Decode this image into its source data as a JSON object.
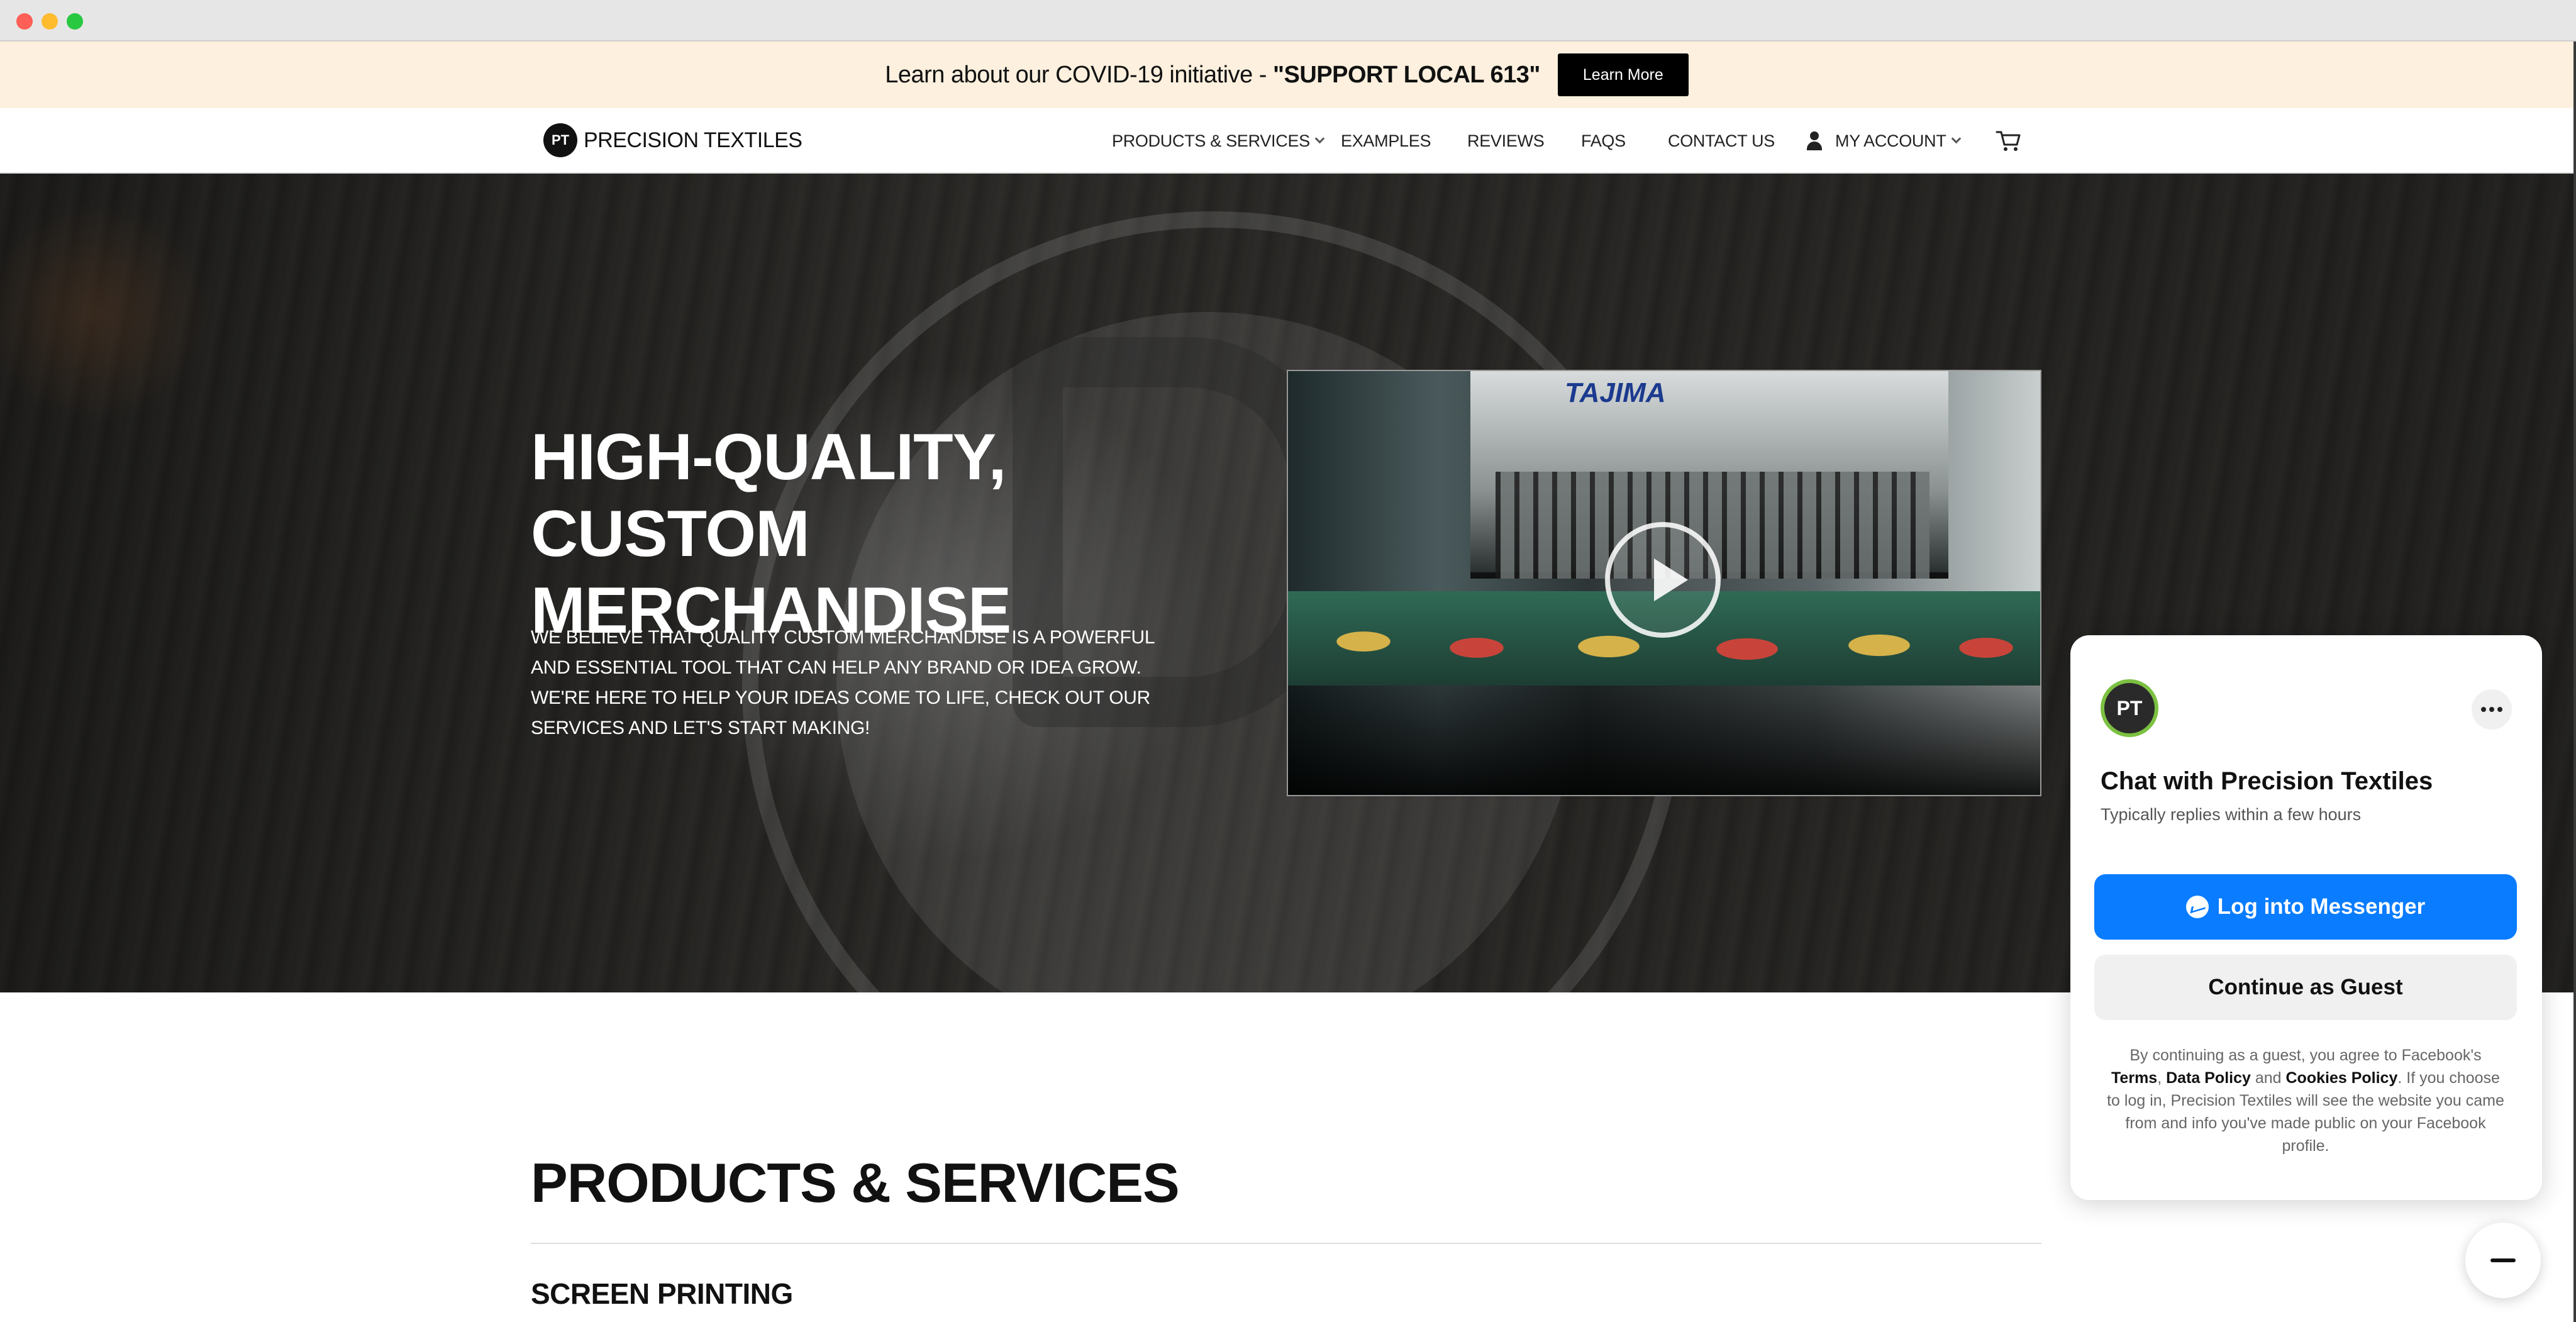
{
  "banner": {
    "text_prefix": "Learn about our COVID-19 initiative - ",
    "text_bold": "\"SUPPORT LOCAL 613\"",
    "button_label": "Learn More"
  },
  "nav": {
    "brand": "PRECISION TEXTILES",
    "items": [
      {
        "label": "PRODUCTS & SERVICES",
        "has_dropdown": true
      },
      {
        "label": "EXAMPLES"
      },
      {
        "label": "REVIEWS"
      },
      {
        "label": "FAQS"
      },
      {
        "label": "CONTACT US"
      },
      {
        "label": "MY ACCOUNT",
        "has_dropdown": true,
        "icon": "user-icon"
      }
    ],
    "cart_icon": "cart-icon"
  },
  "hero": {
    "title": "HIGH-QUALITY, CUSTOM MERCHANDISE",
    "body": "WE BELIEVE THAT QUALITY CUSTOM MERCHANDISE IS A POWERFUL AND ESSENTIAL TOOL THAT CAN HELP ANY BRAND OR IDEA GROW. WE'RE HERE TO HELP YOUR IDEAS COME TO LIFE, CHECK OUT OUR SERVICES AND LET'S START MAKING!",
    "video": {
      "machine_brand": "TAJIMA",
      "play_icon": "play-icon"
    }
  },
  "products": {
    "title": "PRODUCTS & SERVICES",
    "first_service": "SCREEN PRINTING"
  },
  "chat": {
    "title": "Chat with Precision Textiles",
    "subtitle": "Typically replies within a few hours",
    "login_button": "Log into Messenger",
    "guest_button": "Continue as Guest",
    "legal_1": "By continuing as a guest, you agree to Facebook's ",
    "terms": "Terms",
    "comma": ", ",
    "data_policy": "Data Policy",
    "and": " and ",
    "cookies_policy": "Cookies Policy",
    "legal_2": ". If you choose to log in, Precision Textiles will see the website you came from and info you've made public on your Facebook profile."
  },
  "colors": {
    "banner_bg": "#fdf0de",
    "messenger_blue": "#0a7cff",
    "brand_green": "#7cc142"
  }
}
